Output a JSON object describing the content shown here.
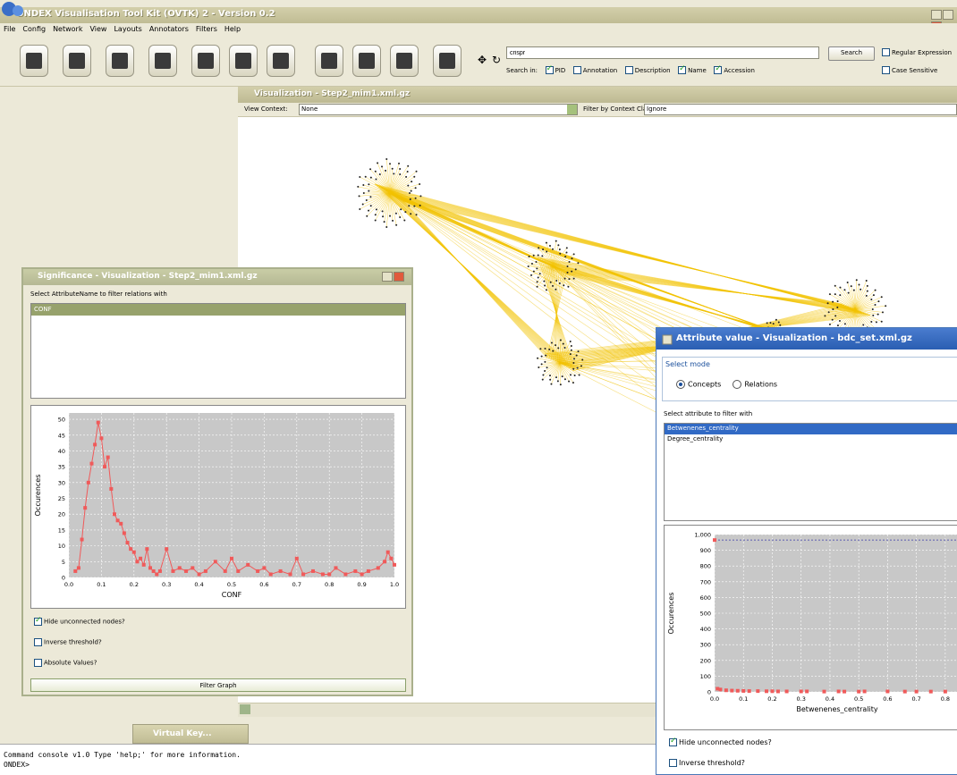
{
  "app": {
    "title": "ONDEX Visualisation Tool Kit (OVTK) 2 - Version 0.2",
    "menu": [
      "File",
      "Config",
      "Network",
      "View",
      "Layouts",
      "Annotators",
      "Filters",
      "Help"
    ]
  },
  "toolbar": {
    "icons": [
      "open-icon",
      "save-icon",
      "tools-icon",
      "info-icon",
      "check-icon",
      "trash-icon",
      "copy-icon",
      "refresh-icon",
      "zoom-in-icon",
      "zoom-out-icon",
      "fit-icon",
      "move-icon",
      "rotate-icon"
    ]
  },
  "search": {
    "value": "crispr",
    "button_label": "Search",
    "search_in_label": "Search in:",
    "options": [
      {
        "label": "PID",
        "checked": true
      },
      {
        "label": "Annotation",
        "checked": false
      },
      {
        "label": "Description",
        "checked": false
      },
      {
        "label": "Name",
        "checked": true
      },
      {
        "label": "Accession",
        "checked": true
      }
    ],
    "regex_label": "Regular Expression",
    "case_label": "Case Sensitive"
  },
  "visualization": {
    "title": "Visualization - Step2_mim1.xml.gz",
    "context_label": "View Context:",
    "context_value": "None",
    "filter_label": "Filter by Context Class:",
    "filter_value": "Ignore"
  },
  "console": {
    "line1": "Command console v1.0 Type 'help;' for more information.",
    "line2": "ONDEX>"
  },
  "virtual_keyboard": {
    "title": "Virtual Key..."
  },
  "significance": {
    "title": "Significance - Visualization - Step2_mim1.xml.gz",
    "prompt": "Select AttributeName to filter relations with",
    "list_items": [
      "CONF"
    ],
    "hide_label": "Hide unconnected nodes?",
    "hide_checked": true,
    "inverse_label": "Inverse threshold?",
    "inverse_checked": false,
    "absolute_label": "Absolute Values?",
    "absolute_checked": false,
    "filter_button": "Filter Graph"
  },
  "attribute": {
    "title": "Attribute value - Visualization - bdc_set.xml.gz",
    "mode_legend": "Select mode",
    "mode_concepts": "Concepts",
    "mode_relations": "Relations",
    "mode_selected": "Concepts",
    "prompt": "Select attribute to filter with",
    "items": [
      "Betwenenes_centrality",
      "Degree_centrality"
    ],
    "selected_index": 0,
    "hide_label": "Hide unconnected nodes?",
    "hide_checked": true,
    "inverse_label": "Inverse threshold?",
    "inverse_checked": false
  },
  "chart_data": [
    {
      "type": "scatter",
      "xlabel": "CONF",
      "ylabel": "Occurences",
      "xlim": [
        0.0,
        1.0
      ],
      "ylim": [
        0,
        52
      ],
      "xticks": [
        "0.0",
        "0.1",
        "0.2",
        "0.3",
        "0.4",
        "0.5",
        "0.6",
        "0.7",
        "0.8",
        "0.9",
        "1.0"
      ],
      "yticks": [
        "0",
        "5",
        "10",
        "15",
        "20",
        "25",
        "30",
        "35",
        "40",
        "45",
        "50"
      ],
      "x": [
        0.02,
        0.03,
        0.04,
        0.05,
        0.06,
        0.07,
        0.08,
        0.09,
        0.1,
        0.11,
        0.12,
        0.13,
        0.14,
        0.15,
        0.16,
        0.17,
        0.18,
        0.19,
        0.2,
        0.21,
        0.22,
        0.23,
        0.24,
        0.25,
        0.26,
        0.27,
        0.28,
        0.3,
        0.32,
        0.34,
        0.36,
        0.38,
        0.4,
        0.42,
        0.45,
        0.48,
        0.5,
        0.52,
        0.55,
        0.58,
        0.6,
        0.62,
        0.65,
        0.68,
        0.7,
        0.72,
        0.75,
        0.78,
        0.8,
        0.82,
        0.85,
        0.88,
        0.9,
        0.92,
        0.95,
        0.97,
        0.98,
        0.99,
        1.0
      ],
      "y": [
        2,
        3,
        12,
        22,
        30,
        36,
        42,
        49,
        44,
        35,
        38,
        28,
        20,
        18,
        17,
        14,
        11,
        9,
        8,
        5,
        6,
        4,
        9,
        3,
        2,
        1,
        2,
        9,
        2,
        3,
        2,
        3,
        1,
        2,
        5,
        2,
        6,
        2,
        4,
        2,
        3,
        1,
        2,
        1,
        6,
        1,
        2,
        1,
        1,
        3,
        1,
        2,
        1,
        2,
        3,
        5,
        8,
        6,
        4
      ]
    },
    {
      "type": "scatter",
      "xlabel": "Betwenenes_centrality",
      "ylabel": "Occurences",
      "xlim": [
        0.0,
        0.85
      ],
      "ylim": [
        0,
        1000
      ],
      "xticks": [
        "0.0",
        "0.1",
        "0.2",
        "0.3",
        "0.4",
        "0.5",
        "0.6",
        "0.7",
        "0.8"
      ],
      "yticks": [
        "0",
        "100",
        "200",
        "300",
        "400",
        "500",
        "600",
        "700",
        "800",
        "900",
        "1,000"
      ],
      "x": [
        0.0,
        0.01,
        0.02,
        0.04,
        0.06,
        0.08,
        0.1,
        0.12,
        0.15,
        0.18,
        0.2,
        0.22,
        0.25,
        0.3,
        0.32,
        0.38,
        0.43,
        0.45,
        0.5,
        0.52,
        0.6,
        0.66,
        0.7,
        0.75,
        0.8
      ],
      "y": [
        965,
        20,
        15,
        10,
        8,
        7,
        6,
        5,
        5,
        4,
        4,
        3,
        3,
        3,
        3,
        2,
        3,
        2,
        2,
        3,
        3,
        2,
        2,
        2,
        2
      ],
      "reference_line": 965
    }
  ]
}
